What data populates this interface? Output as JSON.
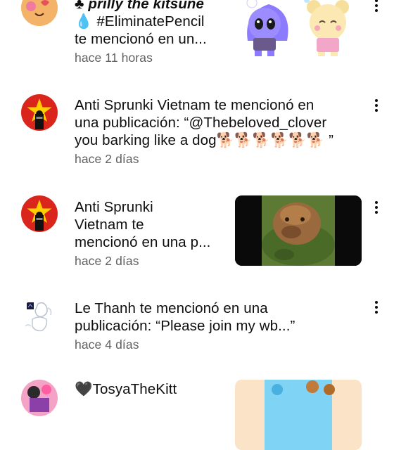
{
  "notifications": [
    {
      "line1": "prilly the kitsune",
      "line1_prefix": "♣",
      "line2": "#EliminatePencil",
      "line2_prefix": "💧",
      "line3": "te mencionó en un...",
      "time": "hace 11 horas",
      "avatar": "avatar-cartoon"
    },
    {
      "line1": "Anti Sprunki Vietnam te mencionó en",
      "line2": "una publicación: “@Thebeloved_clover",
      "line3": "you barking like a dog🐕🐕🐕🐕🐕🐕 ”",
      "time": "hace 2 días",
      "avatar": "vietnam-flag-avatar"
    },
    {
      "line1": "Anti Sprunki",
      "line2": "Vietnam te",
      "line3": "mencionó en una p...",
      "time": "hace 2 días",
      "avatar": "vietnam-flag-avatar"
    },
    {
      "line1": "Le Thanh te mencionó en una",
      "line2": "publicación: “Please join my wb...”",
      "time": "hace 4 días",
      "avatar": "sketch-avatar"
    },
    {
      "line1": "TosyaTheKitt",
      "line1_prefix": "🖤",
      "avatar": "avatar-pink"
    }
  ],
  "colors": {
    "text": "#0f0f0f",
    "secondary": "#606060",
    "flag_red": "#da251d",
    "flag_star": "#ffcd00"
  }
}
